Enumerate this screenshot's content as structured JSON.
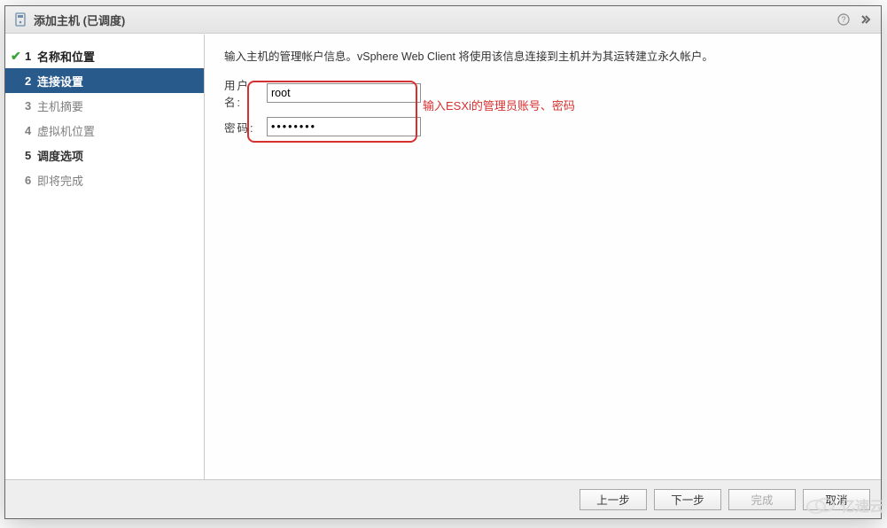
{
  "dialog": {
    "title": "添加主机 (已调度)"
  },
  "steps": [
    {
      "num": "1",
      "label": "名称和位置",
      "state": "done"
    },
    {
      "num": "2",
      "label": "连接设置",
      "state": "active"
    },
    {
      "num": "3",
      "label": "主机摘要",
      "state": "future"
    },
    {
      "num": "4",
      "label": "虚拟机位置",
      "state": "future"
    },
    {
      "num": "5",
      "label": "调度选项",
      "state": "upcoming-strong"
    },
    {
      "num": "6",
      "label": "即将完成",
      "state": "future"
    }
  ],
  "main": {
    "intro": "输入主机的管理帐户信息。vSphere Web Client 将使用该信息连接到主机并为其运转建立永久帐户。",
    "username_label": "用户名:",
    "password_label": "密码:",
    "username_value": "root",
    "password_value": "********",
    "callout_note": "输入ESXi的管理员账号、密码"
  },
  "footer": {
    "back": "上一步",
    "next": "下一步",
    "finish": "完成",
    "cancel": "取消"
  },
  "watermark": "亿速云"
}
